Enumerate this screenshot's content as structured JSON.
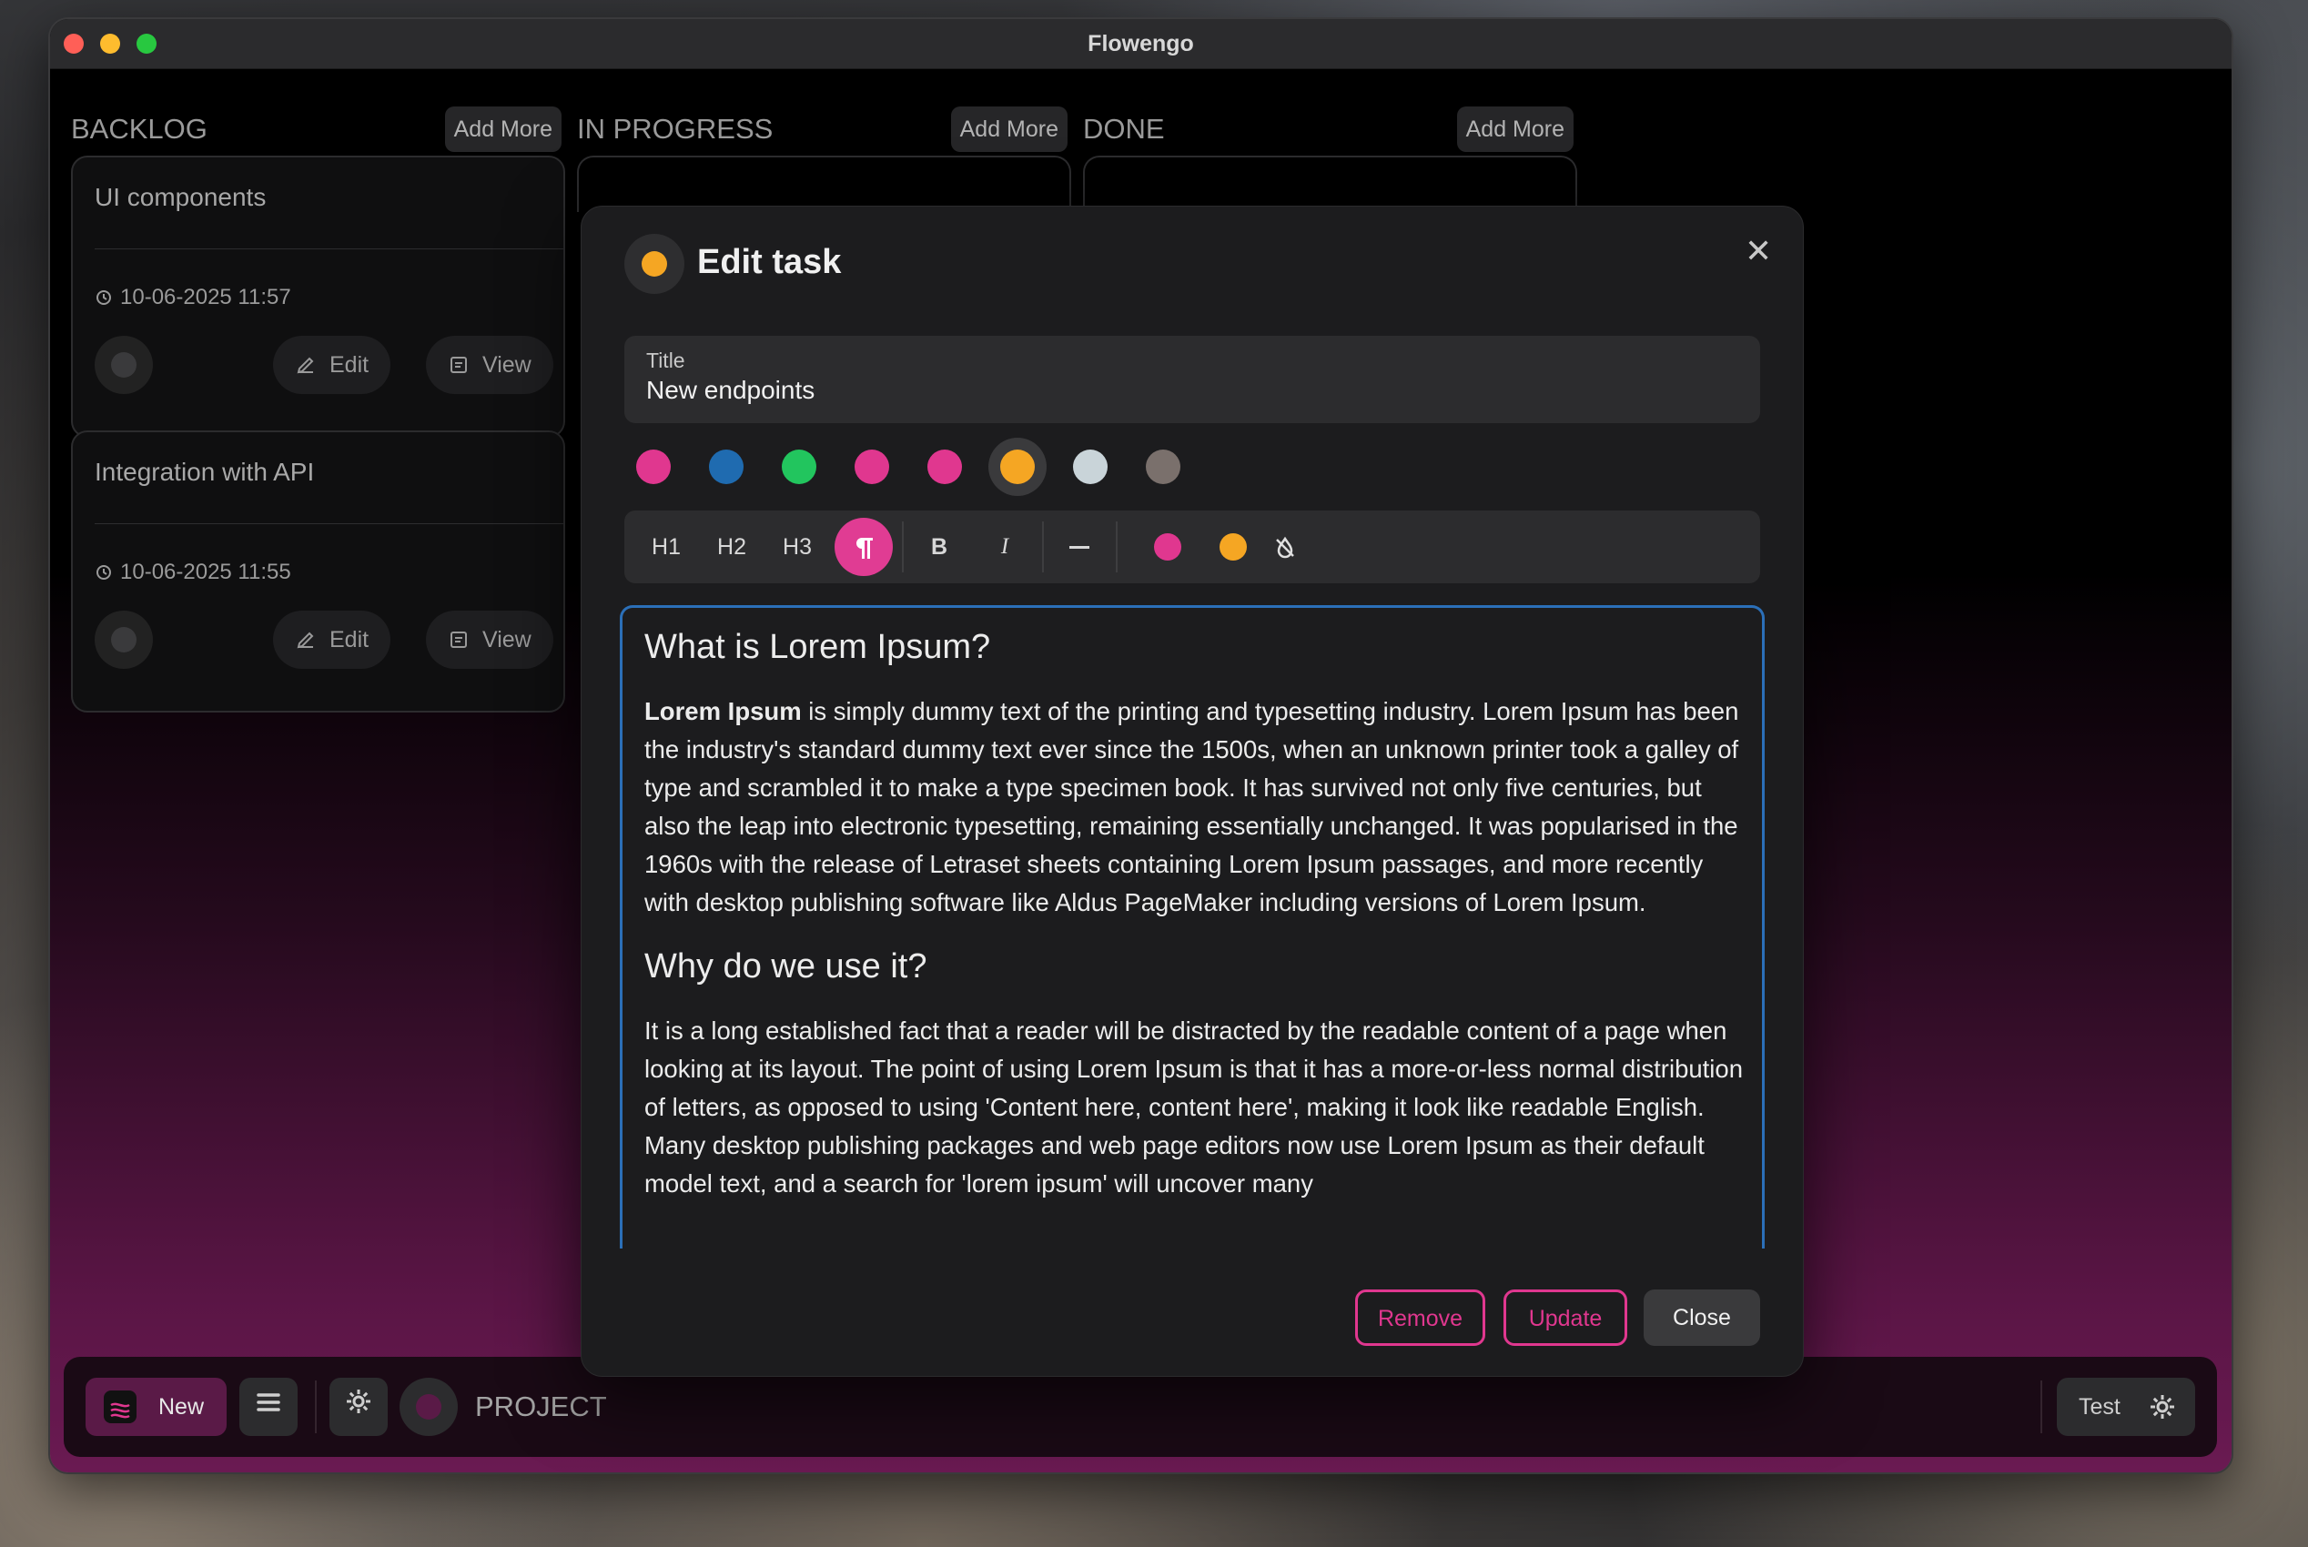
{
  "window": {
    "title": "Flowengo"
  },
  "columns": [
    {
      "title": "BACKLOG",
      "add_label": "Add More"
    },
    {
      "title": "IN PROGRESS",
      "add_label": "Add More"
    },
    {
      "title": "DONE",
      "add_label": "Add More"
    }
  ],
  "backlog_cards": [
    {
      "title": "UI components",
      "date": "10-06-2025 11:57",
      "edit_label": "Edit",
      "view_label": "View"
    },
    {
      "title": "Integration with API",
      "date": "10-06-2025 11:55",
      "edit_label": "Edit",
      "view_label": "View"
    }
  ],
  "modal": {
    "title": "Edit task",
    "accent_color": "#f5a623",
    "title_field": {
      "label": "Title",
      "value": "New endpoints"
    },
    "swatches": [
      "#e0378f",
      "#1f6bb0",
      "#22c55e",
      "#e0378f",
      "#e0378f",
      "#f5a623",
      "#c9d4d9",
      "#7a706c"
    ],
    "selected_swatch_index": 5,
    "toolbar": {
      "h1": "H1",
      "h2": "H2",
      "h3": "H3",
      "paragraph_icon": "paragraph-icon",
      "bold": "B",
      "italic": "I",
      "hr_icon": "horizontal-rule-icon",
      "text_colors": [
        "#e0378f",
        "#f5a623"
      ],
      "clear_color_icon": "no-color-icon"
    },
    "content": {
      "heading1": "What is Lorem Ipsum?",
      "p1_bold": "Lorem Ipsum",
      "p1_rest": " is simply dummy text of the printing and typesetting industry. Lorem Ipsum has been the industry's standard dummy text ever since the 1500s, when an unknown printer took a galley of type and scrambled it to make a type specimen book. It has survived not only five centuries, but also the leap into electronic typesetting, remaining essentially unchanged. It was popularised in the 1960s with the release of Letraset sheets containing Lorem Ipsum passages, and more recently with desktop publishing software like Aldus PageMaker including versions of Lorem Ipsum.",
      "heading2": "Why do we use it?",
      "p2": "It is a long established fact that a reader will be distracted by the readable content of a page when looking at its layout. The point of using Lorem Ipsum is that it has a more-or-less normal distribution of letters, as opposed to using 'Content here, content here', making it look like readable English. Many desktop publishing packages and web page editors now use Lorem Ipsum as their default model text, and a search for 'lorem ipsum' will uncover many"
    },
    "buttons": {
      "remove": "Remove",
      "update": "Update",
      "close": "Close"
    }
  },
  "bottombar": {
    "new_label": "New",
    "project_label": "PROJECT",
    "user_label": "Test"
  }
}
